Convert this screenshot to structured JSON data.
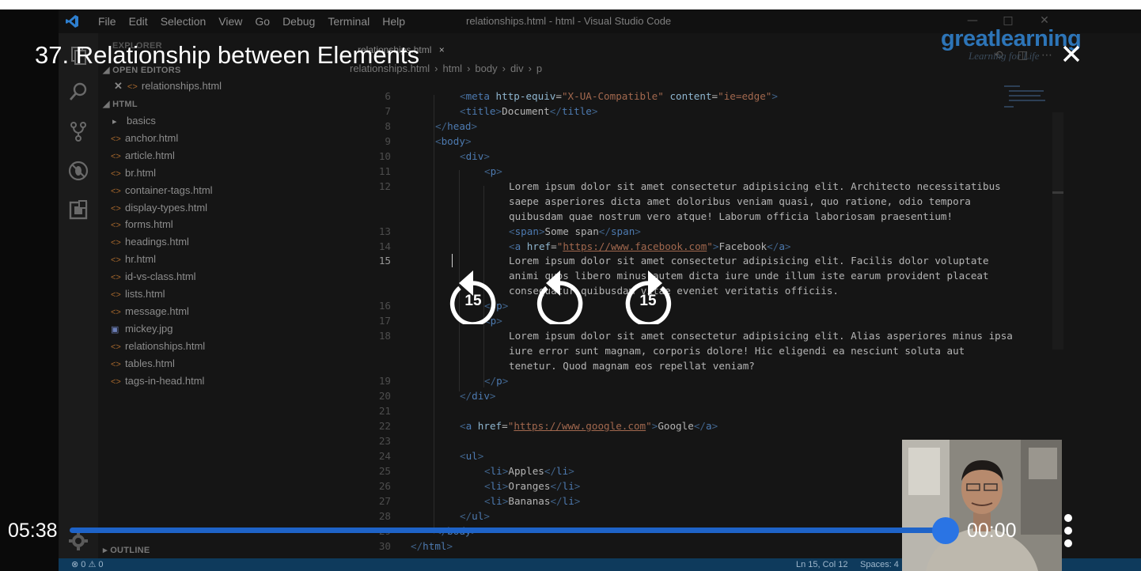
{
  "player": {
    "title": "37. Relationship between Elements",
    "elapsed": "05:38",
    "remaining": "00:00",
    "progress_fraction": 1.0,
    "rewind_seconds": "15",
    "forward_seconds": "15"
  },
  "logo": {
    "main": "greatlearning",
    "tagline": "Learning for Life"
  },
  "vscode": {
    "menu": [
      "File",
      "Edit",
      "Selection",
      "View",
      "Go",
      "Debug",
      "Terminal",
      "Help"
    ],
    "window_title": "relationships.html - html - Visual Studio Code",
    "explorer_label": "EXPLORER",
    "open_editors_label": "OPEN EDITORS",
    "open_editor_file": "relationships.html",
    "folder_label": "HTML",
    "outline_label": "OUTLINE",
    "tree": [
      {
        "name": "basics",
        "kind": "folder"
      },
      {
        "name": "anchor.html",
        "kind": "html"
      },
      {
        "name": "article.html",
        "kind": "html"
      },
      {
        "name": "br.html",
        "kind": "html"
      },
      {
        "name": "container-tags.html",
        "kind": "html"
      },
      {
        "name": "display-types.html",
        "kind": "html"
      },
      {
        "name": "forms.html",
        "kind": "html"
      },
      {
        "name": "headings.html",
        "kind": "html"
      },
      {
        "name": "hr.html",
        "kind": "html"
      },
      {
        "name": "id-vs-class.html",
        "kind": "html"
      },
      {
        "name": "lists.html",
        "kind": "html"
      },
      {
        "name": "message.html",
        "kind": "html"
      },
      {
        "name": "mickey.jpg",
        "kind": "image"
      },
      {
        "name": "relationships.html",
        "kind": "html"
      },
      {
        "name": "tables.html",
        "kind": "html"
      },
      {
        "name": "tags-in-head.html",
        "kind": "html"
      }
    ],
    "tab": {
      "label": "relationships.html",
      "close": "×"
    },
    "breadcrumbs": [
      "relationships.html",
      "html",
      "body",
      "div",
      "p"
    ],
    "status": {
      "errors": "0",
      "warnings": "0",
      "position": "Ln 15, Col 12",
      "spaces": "Spaces: 4"
    },
    "active_line": 15,
    "code_lines": [
      {
        "n": "6",
        "parts": [
          [
            "tg",
            "<"
          ],
          [
            "tn",
            "meta"
          ],
          [
            "tx",
            " "
          ],
          [
            "at",
            "http-equiv"
          ],
          [
            "tx",
            "="
          ],
          [
            "sv",
            "\"X-UA-Compatible\""
          ],
          [
            "tx",
            " "
          ],
          [
            "at",
            "content"
          ],
          [
            "tx",
            "="
          ],
          [
            "sv",
            "\"ie=edge\""
          ],
          [
            "tg",
            ">"
          ]
        ],
        "indent": 2
      },
      {
        "n": "7",
        "parts": [
          [
            "tg",
            "<"
          ],
          [
            "tn",
            "title"
          ],
          [
            "tg",
            ">"
          ],
          [
            "tx",
            "Document"
          ],
          [
            "tg",
            "</"
          ],
          [
            "tn",
            "title"
          ],
          [
            "tg",
            ">"
          ]
        ],
        "indent": 2
      },
      {
        "n": "8",
        "parts": [
          [
            "tg",
            "</"
          ],
          [
            "tn",
            "head"
          ],
          [
            "tg",
            ">"
          ]
        ],
        "indent": 1
      },
      {
        "n": "9",
        "parts": [
          [
            "tg",
            "<"
          ],
          [
            "tn",
            "body"
          ],
          [
            "tg",
            ">"
          ]
        ],
        "indent": 1
      },
      {
        "n": "10",
        "parts": [
          [
            "tg",
            "<"
          ],
          [
            "tn",
            "div"
          ],
          [
            "tg",
            ">"
          ]
        ],
        "indent": 2
      },
      {
        "n": "11",
        "parts": [
          [
            "tg",
            "<"
          ],
          [
            "tn",
            "p"
          ],
          [
            "tg",
            ">"
          ]
        ],
        "indent": 3
      },
      {
        "n": "12",
        "parts": [
          [
            "tx",
            "Lorem ipsum dolor sit amet consectetur adipisicing elit. Architecto necessitatibus"
          ]
        ],
        "indent": 4
      },
      {
        "n": "",
        "parts": [
          [
            "tx",
            "saepe asperiores dicta amet doloribus veniam quasi, quo ratione, odio tempora"
          ]
        ],
        "indent": 4
      },
      {
        "n": "",
        "parts": [
          [
            "tx",
            "quibusdam quae nostrum vero atque! Laborum officia laboriosam praesentium!"
          ]
        ],
        "indent": 4
      },
      {
        "n": "13",
        "parts": [
          [
            "tg",
            "<"
          ],
          [
            "tn",
            "span"
          ],
          [
            "tg",
            ">"
          ],
          [
            "tx",
            "Some span"
          ],
          [
            "tg",
            "</"
          ],
          [
            "tn",
            "span"
          ],
          [
            "tg",
            ">"
          ]
        ],
        "indent": 4
      },
      {
        "n": "14",
        "parts": [
          [
            "tg",
            "<"
          ],
          [
            "tn",
            "a"
          ],
          [
            "tx",
            " "
          ],
          [
            "at",
            "href"
          ],
          [
            "tx",
            "="
          ],
          [
            "sv",
            "\""
          ],
          [
            "sv ul",
            "https://www.facebook.com"
          ],
          [
            "sv",
            "\""
          ],
          [
            "tg",
            ">"
          ],
          [
            "tx",
            "Facebook"
          ],
          [
            "tg",
            "</"
          ],
          [
            "tn",
            "a"
          ],
          [
            "tg",
            ">"
          ]
        ],
        "indent": 4
      },
      {
        "n": "15",
        "parts": [
          [
            "tx",
            "Lorem ipsum dolor sit amet consectetur adipisicing elit. Facilis dolor voluptate"
          ]
        ],
        "indent": 4
      },
      {
        "n": "",
        "parts": [
          [
            "tx",
            "animi quos libero minus autem dicta iure unde illum iste earum provident placeat"
          ]
        ],
        "indent": 4
      },
      {
        "n": "",
        "parts": [
          [
            "tx",
            "consequatur quibusdam vitae eveniet veritatis officiis."
          ]
        ],
        "indent": 4
      },
      {
        "n": "16",
        "parts": [
          [
            "tg",
            "</"
          ],
          [
            "tn",
            "p"
          ],
          [
            "tg",
            ">"
          ]
        ],
        "indent": 3
      },
      {
        "n": "17",
        "parts": [
          [
            "tg",
            "<"
          ],
          [
            "tn",
            "p"
          ],
          [
            "tg",
            ">"
          ]
        ],
        "indent": 3
      },
      {
        "n": "18",
        "parts": [
          [
            "tx",
            "Lorem ipsum dolor sit amet consectetur adipisicing elit. Alias asperiores minus ipsa"
          ]
        ],
        "indent": 4
      },
      {
        "n": "",
        "parts": [
          [
            "tx",
            "iure error sunt magnam, corporis dolore! Hic eligendi ea nesciunt soluta aut"
          ]
        ],
        "indent": 4
      },
      {
        "n": "",
        "parts": [
          [
            "tx",
            "tenetur. Quod magnam eos repellat veniam?"
          ]
        ],
        "indent": 4
      },
      {
        "n": "19",
        "parts": [
          [
            "tg",
            "</"
          ],
          [
            "tn",
            "p"
          ],
          [
            "tg",
            ">"
          ]
        ],
        "indent": 3
      },
      {
        "n": "20",
        "parts": [
          [
            "tg",
            "</"
          ],
          [
            "tn",
            "div"
          ],
          [
            "tg",
            ">"
          ]
        ],
        "indent": 2
      },
      {
        "n": "21",
        "parts": [],
        "indent": 0
      },
      {
        "n": "22",
        "parts": [
          [
            "tg",
            "<"
          ],
          [
            "tn",
            "a"
          ],
          [
            "tx",
            " "
          ],
          [
            "at",
            "href"
          ],
          [
            "tx",
            "="
          ],
          [
            "sv",
            "\""
          ],
          [
            "sv ul",
            "https://www.google.com"
          ],
          [
            "sv",
            "\""
          ],
          [
            "tg",
            ">"
          ],
          [
            "tx",
            "Google"
          ],
          [
            "tg",
            "</"
          ],
          [
            "tn",
            "a"
          ],
          [
            "tg",
            ">"
          ]
        ],
        "indent": 2
      },
      {
        "n": "23",
        "parts": [],
        "indent": 0
      },
      {
        "n": "24",
        "parts": [
          [
            "tg",
            "<"
          ],
          [
            "tn",
            "ul"
          ],
          [
            "tg",
            ">"
          ]
        ],
        "indent": 2
      },
      {
        "n": "25",
        "parts": [
          [
            "tg",
            "<"
          ],
          [
            "tn",
            "li"
          ],
          [
            "tg",
            ">"
          ],
          [
            "tx",
            "Apples"
          ],
          [
            "tg",
            "</"
          ],
          [
            "tn",
            "li"
          ],
          [
            "tg",
            ">"
          ]
        ],
        "indent": 3
      },
      {
        "n": "26",
        "parts": [
          [
            "tg",
            "<"
          ],
          [
            "tn",
            "li"
          ],
          [
            "tg",
            ">"
          ],
          [
            "tx",
            "Oranges"
          ],
          [
            "tg",
            "</"
          ],
          [
            "tn",
            "li"
          ],
          [
            "tg",
            ">"
          ]
        ],
        "indent": 3
      },
      {
        "n": "27",
        "parts": [
          [
            "tg",
            "<"
          ],
          [
            "tn",
            "li"
          ],
          [
            "tg",
            ">"
          ],
          [
            "tx",
            "Bananas"
          ],
          [
            "tg",
            "</"
          ],
          [
            "tn",
            "li"
          ],
          [
            "tg",
            ">"
          ]
        ],
        "indent": 3
      },
      {
        "n": "28",
        "parts": [
          [
            "tg",
            "</"
          ],
          [
            "tn",
            "ul"
          ],
          [
            "tg",
            ">"
          ]
        ],
        "indent": 2
      },
      {
        "n": "29",
        "parts": [
          [
            "tg",
            "</"
          ],
          [
            "tn",
            "body"
          ],
          [
            "tg",
            ">"
          ]
        ],
        "indent": 1
      },
      {
        "n": "30",
        "parts": [
          [
            "tg",
            "</"
          ],
          [
            "tn",
            "html"
          ],
          [
            "tg",
            ">"
          ]
        ],
        "indent": 0
      }
    ]
  }
}
